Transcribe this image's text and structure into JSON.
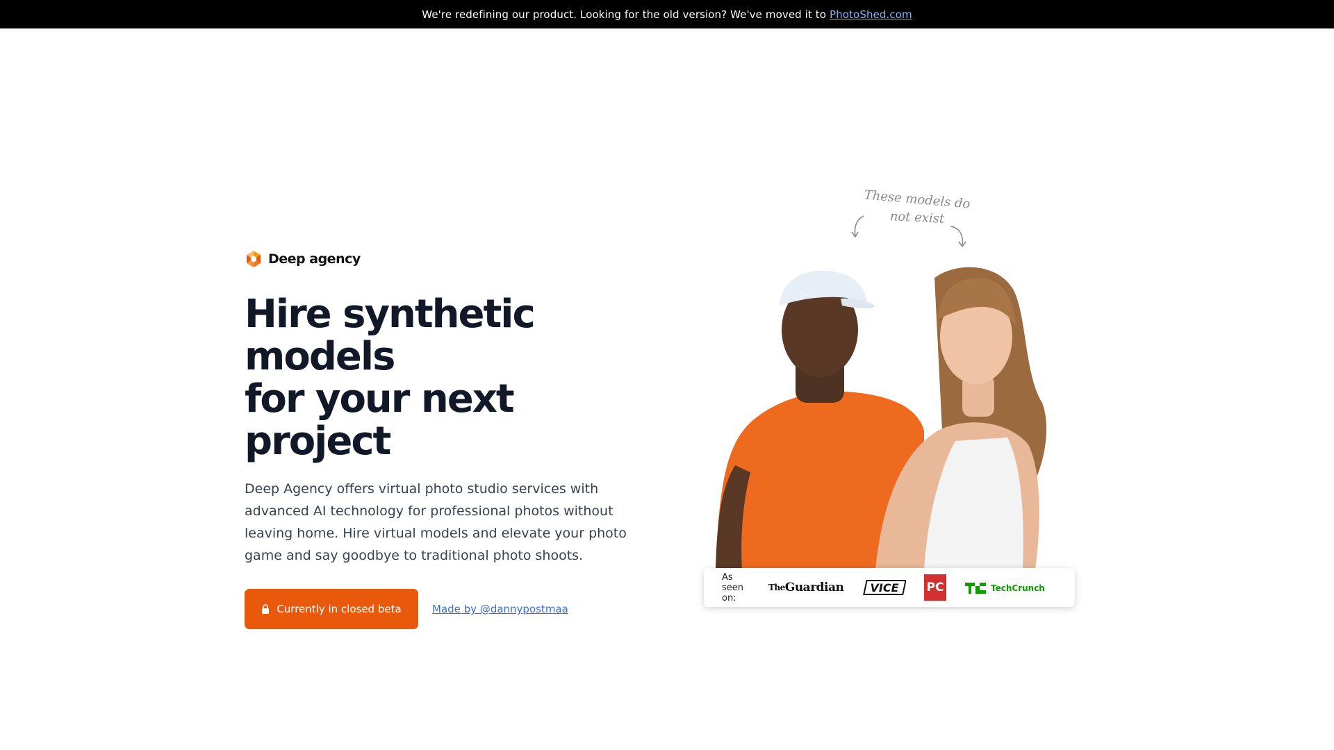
{
  "banner": {
    "text": "We're redefining our product. Looking for the old version? We've moved it to",
    "link_label": "PhotoShed.com"
  },
  "brand": {
    "name": "Deep agency",
    "logo_icon": "deep-agency-logo-icon"
  },
  "hero": {
    "headline_line1": "Hire synthetic models",
    "headline_line2": "for your next project",
    "description": "Deep Agency offers virtual photo studio services with advanced AI technology for professional photos without leaving home. Hire virtual models and elevate your photo game and say goodbye to traditional photo shoots.",
    "cta_label": "Currently in closed beta",
    "cta_icon": "lock-icon",
    "made_by_label": "Made by @dannypostmaa"
  },
  "illustration": {
    "note_line1": "These models do",
    "note_line2": "not exist"
  },
  "press": {
    "label": "As seen on:",
    "logos": [
      {
        "name": "The Guardian",
        "line1": "The",
        "line2": "Guardian"
      },
      {
        "name": "VICE",
        "text": "VICE"
      },
      {
        "name": "PC Magazine",
        "text": "PC"
      },
      {
        "name": "TechCrunch",
        "mark": "TC",
        "text": "TechCrunch"
      }
    ]
  },
  "colors": {
    "accent": "#e8590c",
    "banner_bg": "#000000",
    "heading": "#111827",
    "body_text": "#374151",
    "link": "#3b6fd4",
    "techcrunch_green": "#0a9e01",
    "pcmag_red": "#d32f2f"
  }
}
